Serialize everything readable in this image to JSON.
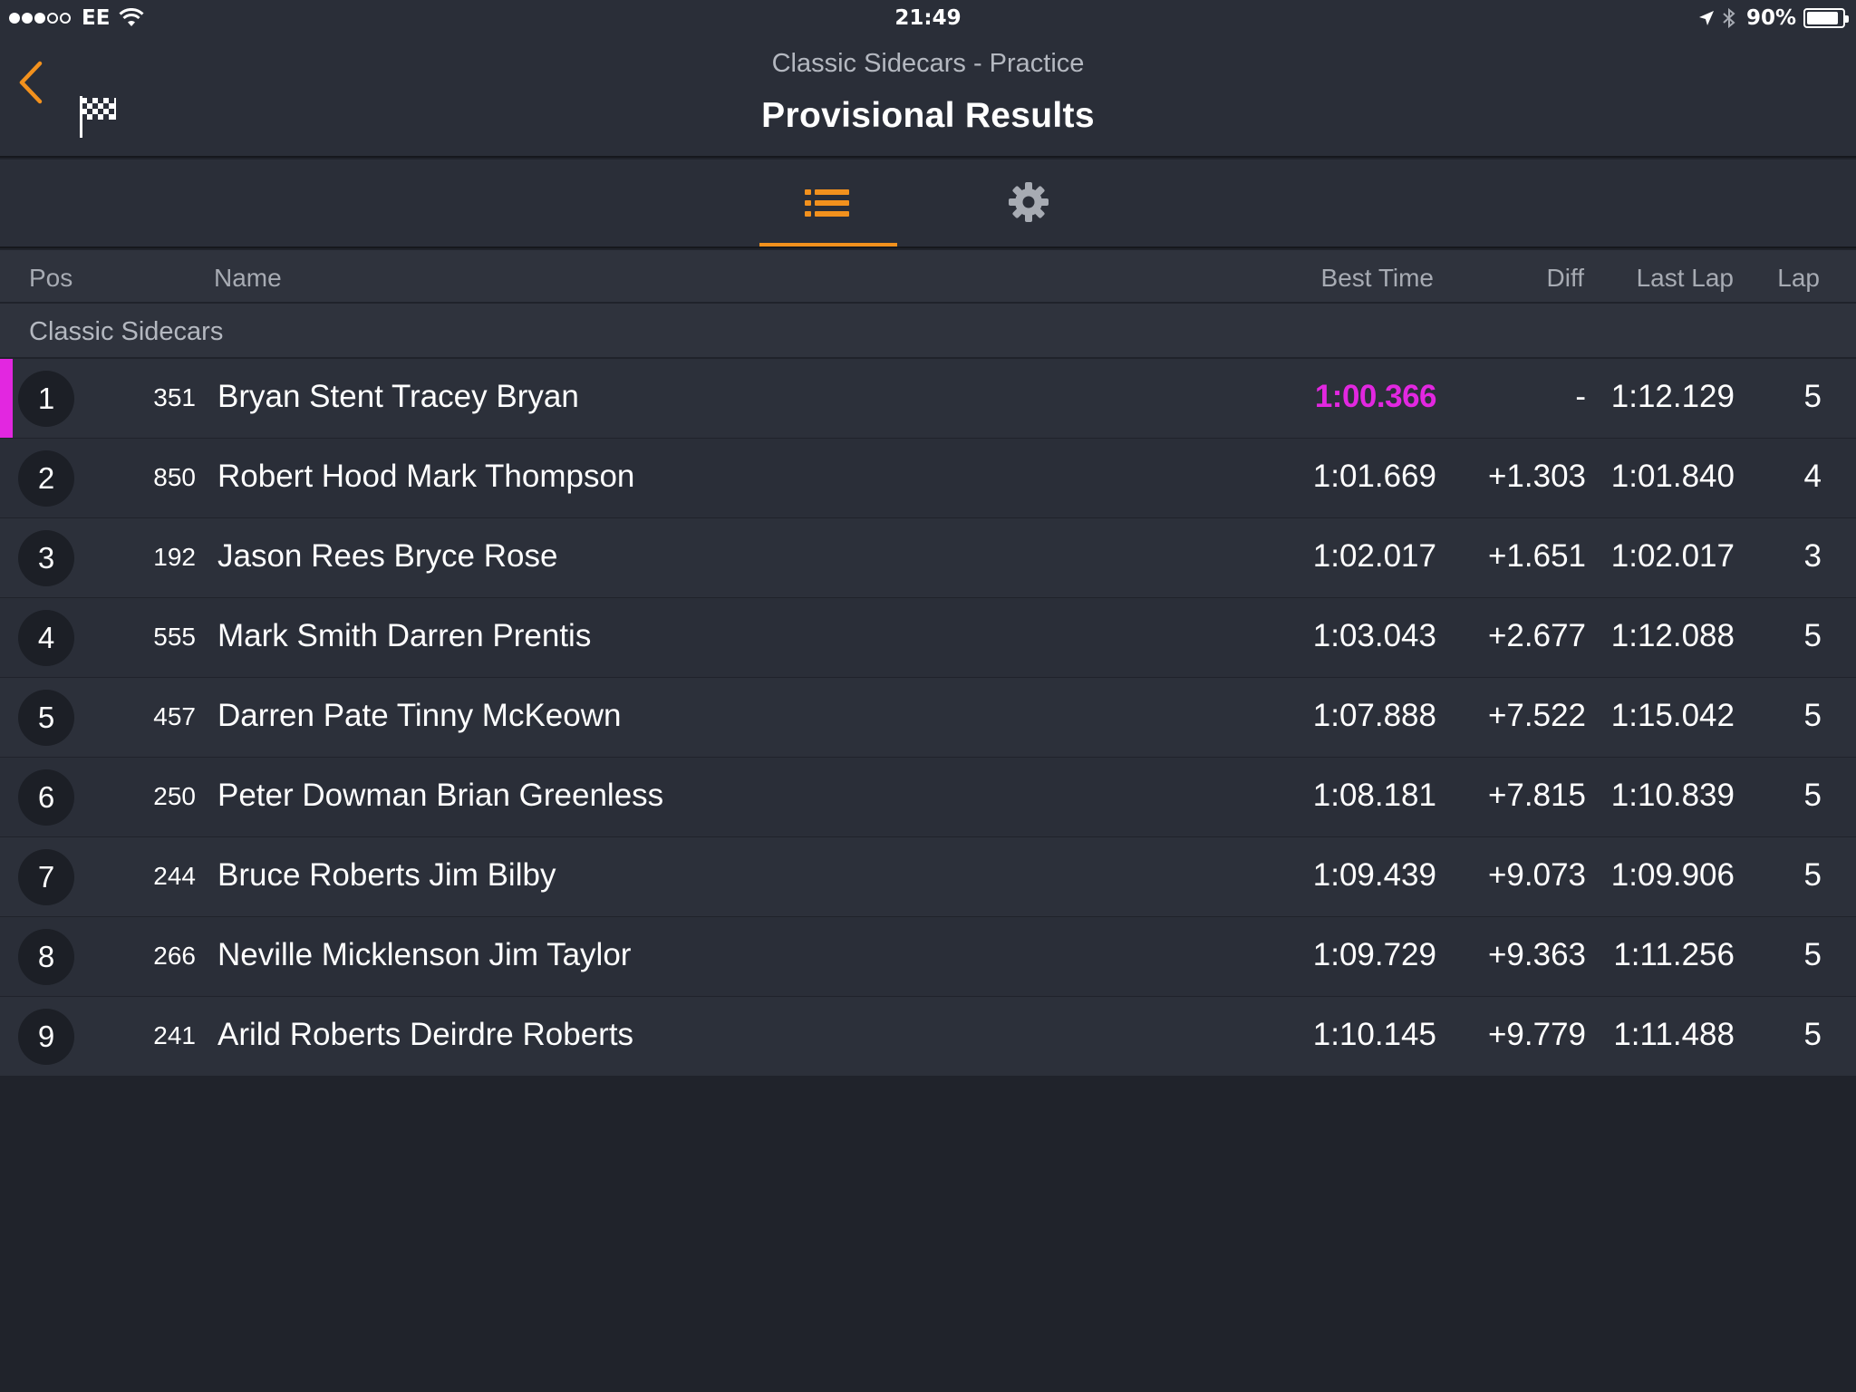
{
  "status_bar": {
    "carrier": "EE",
    "time": "21:49",
    "battery": "90%",
    "battery_level": 0.9,
    "signal_bars_filled": 3,
    "signal_bars_total": 5
  },
  "nav": {
    "subtitle": "Classic Sidecars - Practice",
    "title": "Provisional Results",
    "back_icon": "chevron-left-icon",
    "flag_icon": "checkered-flag-icon",
    "accent_color": "#f2911d"
  },
  "tabs": [
    {
      "icon": "list-icon",
      "selected": true
    },
    {
      "icon": "gear-icon",
      "selected": false
    }
  ],
  "columns": {
    "pos": "Pos",
    "name": "Name",
    "best_time": "Best Time",
    "diff": "Diff",
    "last_lap": "Last Lap",
    "lap": "Lap"
  },
  "class_name": "Classic Sidecars",
  "fastest_color": "#e227e0",
  "results": [
    {
      "pos": "1",
      "number": "351",
      "name": "Bryan Stent Tracey Bryan",
      "best": "1:00.366",
      "diff": "-",
      "last": "1:12.129",
      "lap": "5",
      "fastest": true
    },
    {
      "pos": "2",
      "number": "850",
      "name": "Robert Hood Mark Thompson",
      "best": "1:01.669",
      "diff": "+1.303",
      "last": "1:01.840",
      "lap": "4",
      "fastest": false
    },
    {
      "pos": "3",
      "number": "192",
      "name": "Jason Rees Bryce Rose",
      "best": "1:02.017",
      "diff": "+1.651",
      "last": "1:02.017",
      "lap": "3",
      "fastest": false
    },
    {
      "pos": "4",
      "number": "555",
      "name": "Mark Smith Darren Prentis",
      "best": "1:03.043",
      "diff": "+2.677",
      "last": "1:12.088",
      "lap": "5",
      "fastest": false
    },
    {
      "pos": "5",
      "number": "457",
      "name": "Darren Pate Tinny McKeown",
      "best": "1:07.888",
      "diff": "+7.522",
      "last": "1:15.042",
      "lap": "5",
      "fastest": false
    },
    {
      "pos": "6",
      "number": "250",
      "name": "Peter Dowman Brian Greenless",
      "best": "1:08.181",
      "diff": "+7.815",
      "last": "1:10.839",
      "lap": "5",
      "fastest": false
    },
    {
      "pos": "7",
      "number": "244",
      "name": "Bruce Roberts Jim Bilby",
      "best": "1:09.439",
      "diff": "+9.073",
      "last": "1:09.906",
      "lap": "5",
      "fastest": false
    },
    {
      "pos": "8",
      "number": "266",
      "name": "Neville Micklenson Jim Taylor",
      "best": "1:09.729",
      "diff": "+9.363",
      "last": "1:11.256",
      "lap": "5",
      "fastest": false
    },
    {
      "pos": "9",
      "number": "241",
      "name": "Arild Roberts Deirdre Roberts",
      "best": "1:10.145",
      "diff": "+9.779",
      "last": "1:11.488",
      "lap": "5",
      "fastest": false
    }
  ]
}
